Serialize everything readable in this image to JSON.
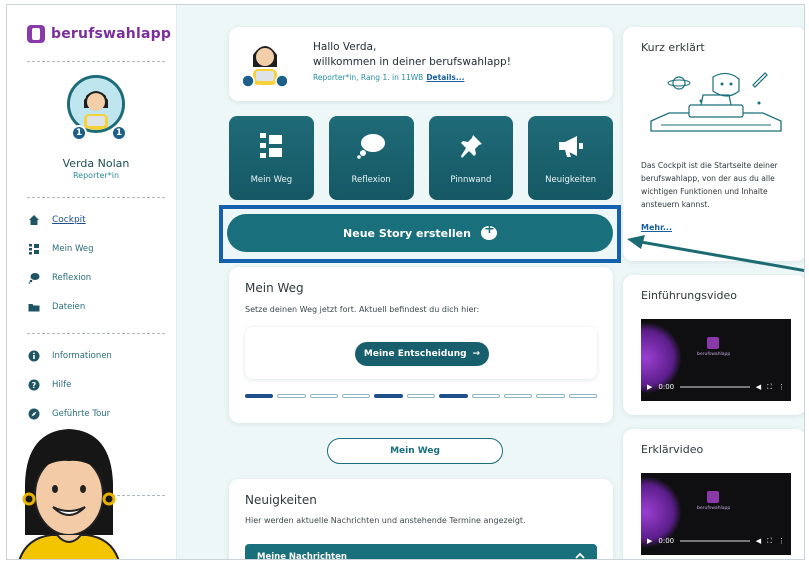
{
  "brand": {
    "name": "berufswahlapp",
    "accent": "#7a2f9a"
  },
  "user": {
    "name": "Verda Nolan",
    "role": "Reporter*in",
    "badge_left": "1",
    "badge_right": "1"
  },
  "sidebar": {
    "items": [
      {
        "label": "Cockpit",
        "icon": "home-icon",
        "active": true
      },
      {
        "label": "Mein Weg",
        "icon": "path-icon"
      },
      {
        "label": "Reflexion",
        "icon": "chat-bubble-icon"
      },
      {
        "label": "Dateien",
        "icon": "folder-icon"
      },
      {
        "label": "Informationen",
        "icon": "info-icon"
      },
      {
        "label": "Hilfe",
        "icon": "help-icon"
      },
      {
        "label": "Geführte Tour",
        "icon": "compass-icon"
      }
    ]
  },
  "greeting": {
    "line1": "Hallo Verda,",
    "line2": "willkommen in deiner berufswahlapp!",
    "sub": "Reporter*in, Rang 1. in 11WB",
    "details": "Details..."
  },
  "tiles": [
    {
      "label": "Mein Weg",
      "icon": "path-icon"
    },
    {
      "label": "Reflexion",
      "icon": "thought-bubble-icon"
    },
    {
      "label": "Pinnwand",
      "icon": "pushpin-icon"
    },
    {
      "label": "Neuigkeiten",
      "icon": "megaphone-icon"
    }
  ],
  "story_button": "Neue Story erstellen",
  "mein_weg_card": {
    "title": "Mein Weg",
    "description": "Setze deinen Weg jetzt fort. Aktuell befindest du dich hier:",
    "decision_button": "Meine Entscheidung",
    "progress": [
      1,
      0,
      0,
      0,
      1,
      0,
      1,
      0,
      0,
      0,
      0
    ]
  },
  "mein_weg_button": "Mein Weg",
  "news_card": {
    "title": "Neuigkeiten",
    "description": "Hier werden aktuelle Nachrichten und anstehende Termine angezeigt.",
    "bar_label": "Meine Nachrichten"
  },
  "right": {
    "kurz_title": "Kurz erklärt",
    "kurz_text": "Das Cockpit ist die Startseite deiner berufswahlapp, von der aus du alle wichtigen Funktionen und Inhalte ansteuern kannst.",
    "kurz_more": "Mehr...",
    "video1_title": "Einführungsvideo",
    "video2_title": "Erklärvideo",
    "video_time": "0:00",
    "video_logo_text": "berufswahlapp"
  },
  "colors": {
    "teal": "#1a6f7c",
    "highlight": "#1660b0",
    "arrow": "#1d6b72"
  }
}
